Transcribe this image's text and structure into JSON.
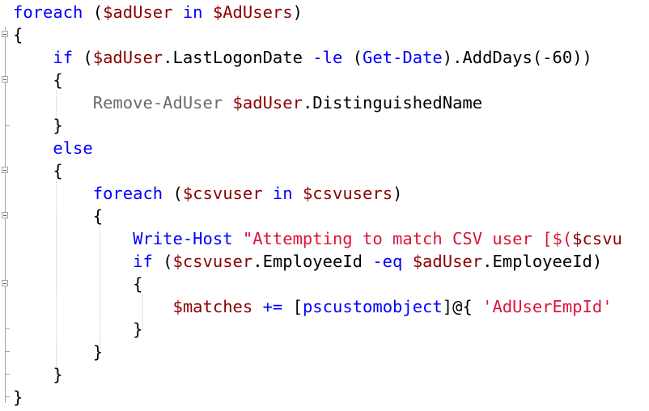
{
  "editor": {
    "language": "PowerShell",
    "lines": [
      [
        {
          "t": "foreach",
          "c": "kw"
        },
        {
          "t": " (",
          "c": "plain"
        },
        {
          "t": "$adUser",
          "c": "var"
        },
        {
          "t": " ",
          "c": "plain"
        },
        {
          "t": "in",
          "c": "kw"
        },
        {
          "t": " ",
          "c": "plain"
        },
        {
          "t": "$AdUsers",
          "c": "var"
        },
        {
          "t": ")",
          "c": "plain"
        }
      ],
      [
        {
          "t": "{",
          "c": "plain"
        }
      ],
      [
        {
          "t": "    ",
          "c": "plain"
        },
        {
          "t": "if",
          "c": "kw"
        },
        {
          "t": " (",
          "c": "plain"
        },
        {
          "t": "$adUser",
          "c": "var"
        },
        {
          "t": ".LastLogonDate ",
          "c": "plain"
        },
        {
          "t": "-le",
          "c": "kw"
        },
        {
          "t": " (",
          "c": "plain"
        },
        {
          "t": "Get-Date",
          "c": "cmd"
        },
        {
          "t": ").AddDays(-60))",
          "c": "plain"
        }
      ],
      [
        {
          "t": "    {",
          "c": "plain"
        }
      ],
      [
        {
          "t": "        ",
          "c": "plain"
        },
        {
          "t": "Remove-AdUser",
          "c": "cmd2"
        },
        {
          "t": " ",
          "c": "plain"
        },
        {
          "t": "$adUser",
          "c": "var"
        },
        {
          "t": ".DistinguishedName",
          "c": "plain"
        }
      ],
      [
        {
          "t": "    }",
          "c": "plain"
        }
      ],
      [
        {
          "t": "    ",
          "c": "plain"
        },
        {
          "t": "else",
          "c": "kw"
        }
      ],
      [
        {
          "t": "    {",
          "c": "plain"
        }
      ],
      [
        {
          "t": "        ",
          "c": "plain"
        },
        {
          "t": "foreach",
          "c": "kw"
        },
        {
          "t": " (",
          "c": "plain"
        },
        {
          "t": "$csvuser",
          "c": "var"
        },
        {
          "t": " ",
          "c": "plain"
        },
        {
          "t": "in",
          "c": "kw"
        },
        {
          "t": " ",
          "c": "plain"
        },
        {
          "t": "$csvusers",
          "c": "var"
        },
        {
          "t": ")",
          "c": "plain"
        }
      ],
      [
        {
          "t": "        {",
          "c": "plain"
        }
      ],
      [
        {
          "t": "            ",
          "c": "plain"
        },
        {
          "t": "Write-Host",
          "c": "cmd"
        },
        {
          "t": " ",
          "c": "plain"
        },
        {
          "t": "\"Attempting to match CSV user [$(",
          "c": "str"
        },
        {
          "t": "$csvu",
          "c": "var"
        }
      ],
      [
        {
          "t": "            ",
          "c": "plain"
        },
        {
          "t": "if",
          "c": "kw"
        },
        {
          "t": " (",
          "c": "plain"
        },
        {
          "t": "$csvuser",
          "c": "var"
        },
        {
          "t": ".EmployeeId ",
          "c": "plain"
        },
        {
          "t": "-eq",
          "c": "kw"
        },
        {
          "t": " ",
          "c": "plain"
        },
        {
          "t": "$adUser",
          "c": "var"
        },
        {
          "t": ".EmployeeId)",
          "c": "plain"
        }
      ],
      [
        {
          "t": "            {",
          "c": "plain"
        }
      ],
      [
        {
          "t": "                ",
          "c": "plain"
        },
        {
          "t": "$matches",
          "c": "var"
        },
        {
          "t": " ",
          "c": "plain"
        },
        {
          "t": "+=",
          "c": "kw"
        },
        {
          "t": " [",
          "c": "plain"
        },
        {
          "t": "pscustomobject",
          "c": "type"
        },
        {
          "t": "]@{ ",
          "c": "plain"
        },
        {
          "t": "'AdUserEmpId'",
          "c": "str"
        }
      ],
      [
        {
          "t": "            }",
          "c": "plain"
        }
      ],
      [
        {
          "t": "        }",
          "c": "plain"
        }
      ],
      [
        {
          "t": "    }",
          "c": "plain"
        }
      ],
      [
        {
          "t": "}",
          "c": "plain"
        }
      ]
    ]
  }
}
